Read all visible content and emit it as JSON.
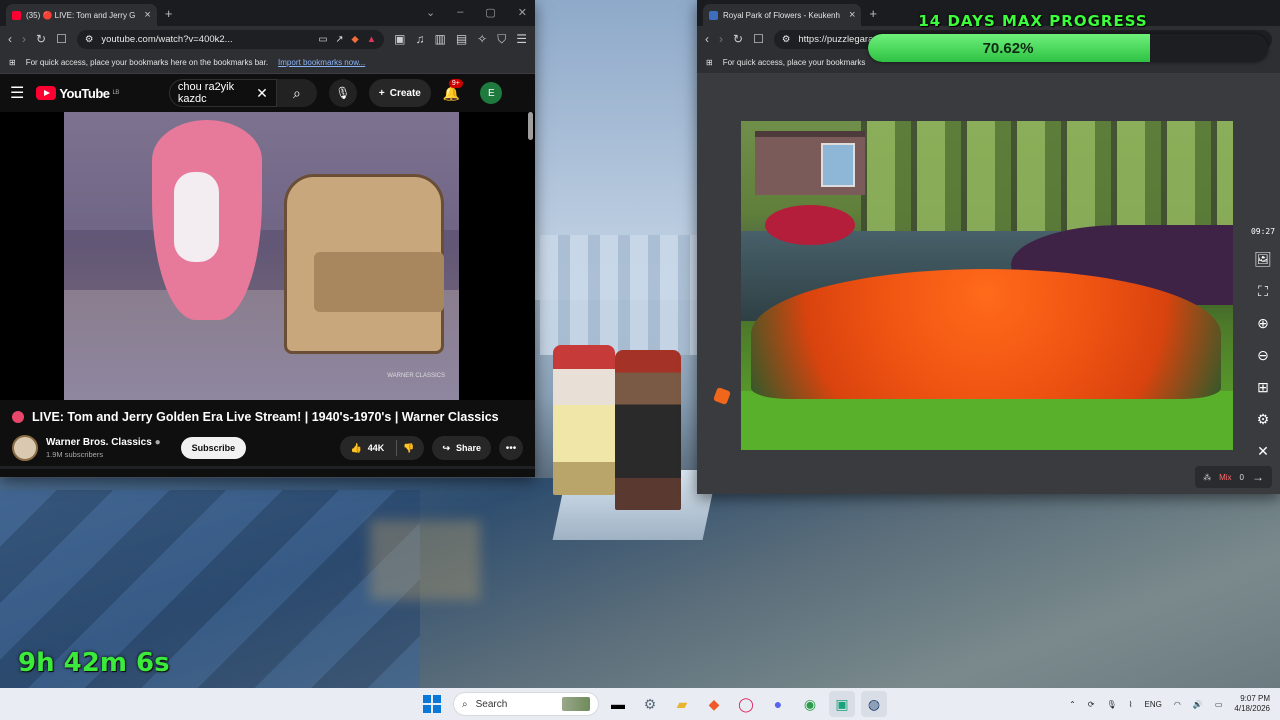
{
  "youtube_window": {
    "tab_title": "(35) 🔴 LIVE: Tom and Jerry G",
    "url": "youtube.com/watch?v=400k2...",
    "bookmarks_hint": "For quick access, place your bookmarks here on the bookmarks bar.",
    "import_link": "Import bookmarks now...",
    "logo_text": "YouTube",
    "logo_region": "LB",
    "search_value": "chou ra2yik kazdc",
    "create_label": "Create",
    "notif_count": "9+",
    "avatar_letter": "E",
    "video_watermark": "WARNER CLASSICS",
    "video_title": "LIVE: Tom and Jerry Golden Era Live Stream! | 1940's-1970's | Warner Classics",
    "channel_name": "Warner Bros. Classics",
    "subscribers": "1.9M subscribers",
    "subscribe_label": "Subscribe",
    "likes": "44K",
    "share_label": "Share",
    "colors": {
      "accent": "#ff0033",
      "live": "#e8466a"
    }
  },
  "puzzle_window": {
    "tab_title": "Royal Park of Flowers - Keukenh",
    "url": "https://puzzlegarage.com/puzzle/6",
    "bookmarks_hint": "For quick access, place your bookmarks",
    "timer": "09:27",
    "tools": [
      "image-icon",
      "fullscreen-icon",
      "zoom-in-icon",
      "zoom-out-icon",
      "grid-icon",
      "settings-icon",
      "close-icon"
    ],
    "mix_label": "Mix",
    "mix_count": "0"
  },
  "overlay": {
    "progress_title": "14 DAYS MAX PROGRESS",
    "progress_percent_text": "70.62%",
    "progress_value": 0.7062,
    "elapsed": "9h 42m 6s",
    "colors": {
      "text": "#3cff3c",
      "fill": "#2fc244"
    }
  },
  "taskbar": {
    "search_placeholder": "Search",
    "apps": [
      "file-explorer-icon",
      "settings-icon",
      "folder-icon",
      "brave-icon",
      "opera-icon",
      "discord-icon",
      "chrome-icon",
      "android-app-icon",
      "steam-icon"
    ],
    "language": "ENG",
    "time": "9:07 PM",
    "date": "4/18/2026"
  }
}
